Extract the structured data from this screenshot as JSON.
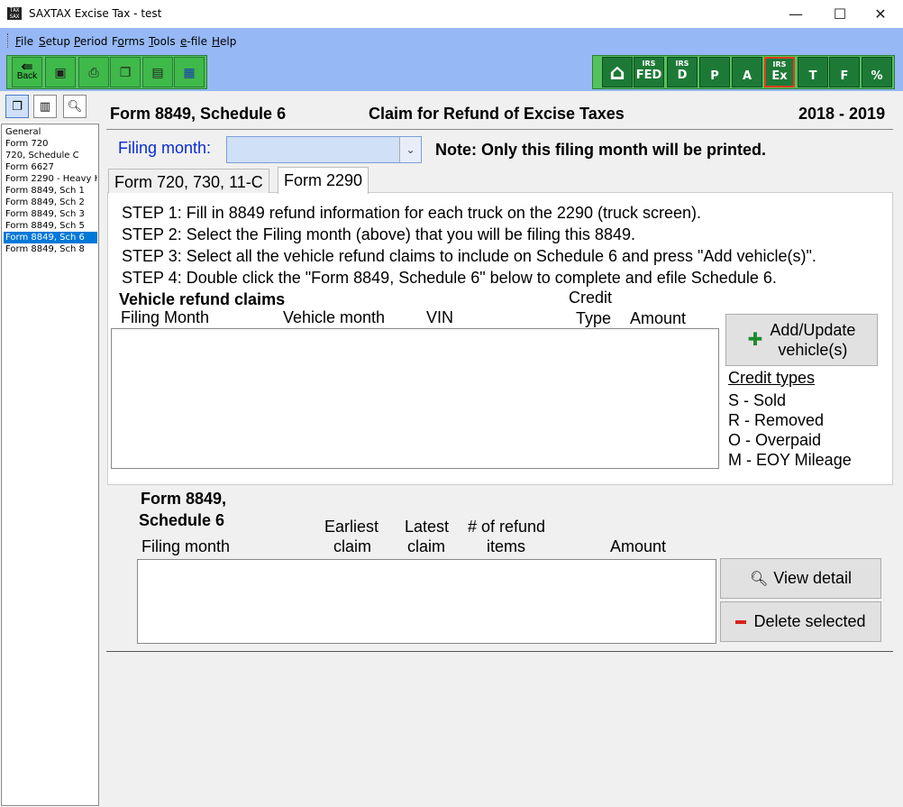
{
  "window": {
    "title": "SAXTAX Excise Tax - test",
    "icon": "saxtax-app-icon",
    "minimize_label": "—",
    "maximize_label": "☐",
    "close_label": "✕"
  },
  "menu": [
    {
      "label": "File",
      "key": "F"
    },
    {
      "label": "Setup",
      "key": "S"
    },
    {
      "label": "Period",
      "key": "P"
    },
    {
      "label": "Forms",
      "key": "o"
    },
    {
      "label": "Tools",
      "key": "T"
    },
    {
      "label": "e-file",
      "key": "e"
    },
    {
      "label": "Help",
      "key": "H"
    }
  ],
  "toolbar": {
    "back_label": "Back",
    "left_icons": [
      "back-icon",
      "save-icon",
      "print-icon",
      "copy-icon",
      "print-preview-icon",
      "calculator-icon"
    ],
    "right_buttons": [
      {
        "top": "",
        "main": "⌂",
        "icon": "home-icon"
      },
      {
        "top": "IRS",
        "main": "FED",
        "icon": "irs-fed-icon"
      },
      {
        "top": "IRS",
        "main": "D",
        "icon": "irs-d-icon"
      },
      {
        "top": "",
        "main": "P",
        "icon": "p-icon"
      },
      {
        "top": "",
        "main": "A",
        "icon": "a-icon"
      },
      {
        "top": "IRS",
        "main": "Ex",
        "icon": "irs-ex-icon",
        "active": true
      },
      {
        "top": "",
        "main": "T",
        "icon": "florida-t-icon"
      },
      {
        "top": "",
        "main": "F",
        "icon": "florida-f-icon"
      },
      {
        "top": "",
        "main": "%",
        "icon": "florida-percent-icon"
      }
    ],
    "accent": "#2fa84a",
    "active_border": "#e53b1d"
  },
  "nav": {
    "tools": [
      "copy-pages-icon",
      "pages-icon",
      "preview-icon"
    ],
    "items": [
      "General",
      "Form 720",
      "720, Schedule C",
      "Form 6627",
      "Form 2290 - Heavy H",
      "Form 8849, Sch 1",
      "Form 8849, Sch 2",
      "Form 8849, Sch 3",
      "Form 8849, Sch 5",
      "Form 8849, Sch 6",
      "Form 8849, Sch 8"
    ],
    "selected_index": 9
  },
  "header": {
    "form": "Form 8849, Schedule 6",
    "title": "Claim for Refund of Excise Taxes",
    "year": "2018 - 2019"
  },
  "filing": {
    "label": "Filing month:",
    "value": "",
    "note": "Note: Only this filing month will be printed."
  },
  "tabs": [
    {
      "label": "Form 720, 730, 11-C",
      "active": false
    },
    {
      "label": "Form 2290",
      "active": true
    }
  ],
  "steps": [
    "STEP 1: Fill in 8849 refund information for each truck on the 2290 (truck screen).",
    "STEP 2: Select the Filing month (above) that you will be filing this 8849.",
    "STEP 3: Select all the vehicle refund claims to include on Schedule 6 and press \"Add vehicle(s)\".",
    "STEP 4: Double click the \"Form 8849, Schedule 6\" below to complete and efile Schedule 6."
  ],
  "vehicle_claims": {
    "title": "Vehicle refund claims",
    "col_filing_month": "Filing Month",
    "col_vehicle_month": "Vehicle month",
    "col_vin": "VIN",
    "col_credit": "Credit",
    "col_type": "Type",
    "col_amount": "Amount",
    "rows": []
  },
  "add_button": {
    "line1": "Add/Update",
    "line2": "vehicle(s)"
  },
  "credit_types": {
    "title": "Credit types",
    "items": [
      "S - Sold",
      "R - Removed",
      "O - Overpaid",
      "M - EOY Mileage"
    ]
  },
  "schedule6": {
    "title_line1": "Form 8849,",
    "title_line2": "Schedule 6",
    "col_filing_month": "Filing month",
    "col_earliest_1": "Earliest",
    "col_earliest_2": "claim",
    "col_latest_1": "Latest",
    "col_latest_2": "claim",
    "col_items_1": "# of refund",
    "col_items_2": "items",
    "col_amount": "Amount",
    "rows": []
  },
  "view_button": "View detail",
  "delete_button": "Delete selected"
}
